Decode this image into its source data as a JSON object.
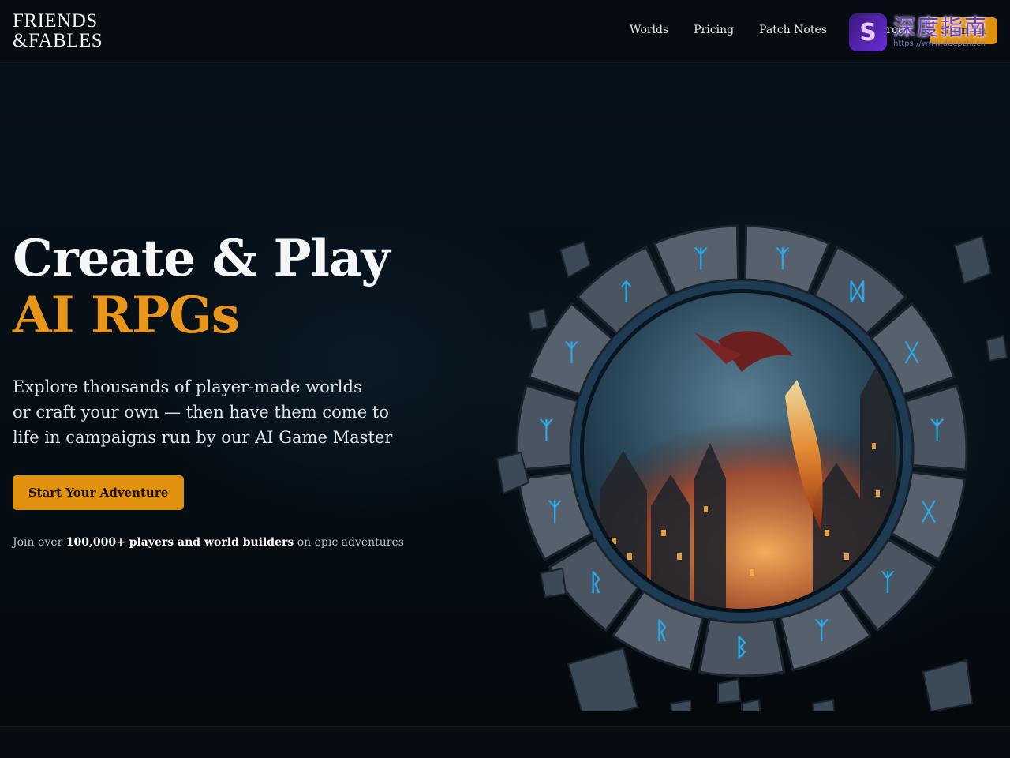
{
  "brand": {
    "logo_line1": "FRIENDS",
    "logo_line2": "&FABLES"
  },
  "nav": {
    "items": [
      "Worlds",
      "Pricing",
      "Patch Notes",
      "Resources"
    ],
    "cta_label": "Sign In"
  },
  "watermark": {
    "title": "深度指南",
    "url": "https://www.deepzhi.cn"
  },
  "hero": {
    "title_line1": "Create & Play",
    "title_line2": "AI RPGs",
    "subtitle_lines": [
      "Explore thousands of player-made worlds",
      "or craft your own — then have them come to",
      "life in campaigns run by our AI Game Master"
    ],
    "cta_label": "Start Your Adventure",
    "social_prefix": "Join over",
    "social_bold": "100,000+ players and world builders",
    "social_suffix": "on epic adventures"
  },
  "colors": {
    "accent": "#e0920f",
    "title_accent": "#e8961a",
    "background": "#050b11",
    "rune_glow": "#2aa9e8"
  },
  "illustration": {
    "name": "rune-portal",
    "rune_glyphs": [
      "ᛉ",
      "ᛞ",
      "ᚷ",
      "ᛉ",
      "ᚷ",
      "ᛉ",
      "ᛉ",
      "ᛒ",
      "ᚱ",
      "ᚱ",
      "ᛉ",
      "ᛉ",
      "ᛉ",
      "ᛏ",
      "ᛉ"
    ]
  }
}
